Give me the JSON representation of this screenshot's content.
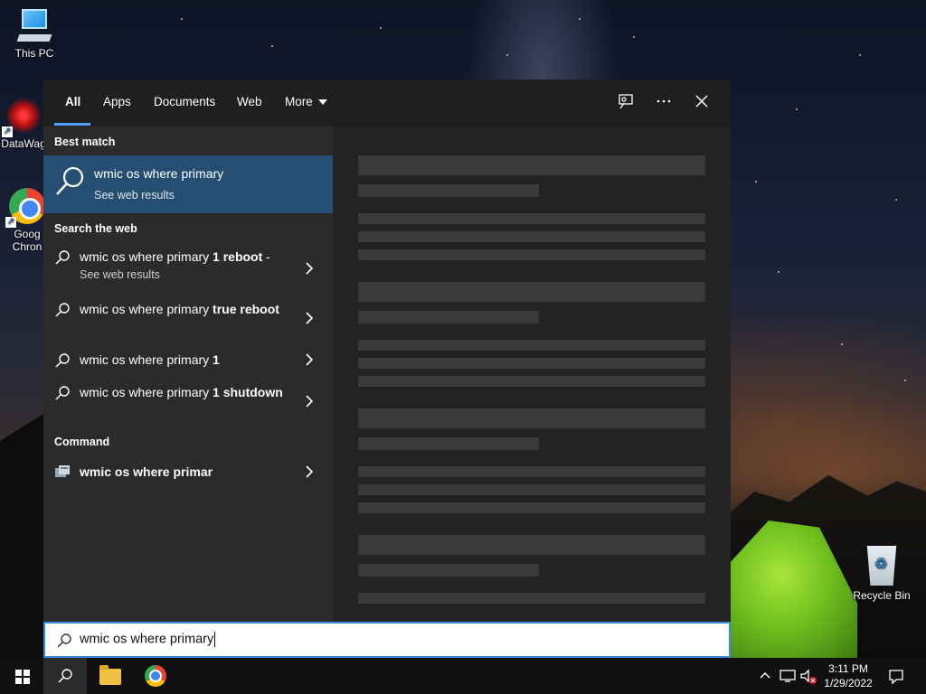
{
  "desktop": {
    "icons": [
      {
        "label": "This PC"
      },
      {
        "label": "DataWag"
      },
      {
        "label": "Goog Chron"
      },
      {
        "label": "Recycle Bin"
      }
    ]
  },
  "search_window": {
    "tabs": [
      {
        "label": "All",
        "active": true
      },
      {
        "label": "Apps"
      },
      {
        "label": "Documents"
      },
      {
        "label": "Web"
      },
      {
        "label": "More"
      }
    ],
    "top_icons": [
      "feedback-icon",
      "more-options-icon",
      "close-icon"
    ],
    "best_match": {
      "heading": "Best match",
      "title": "wmic os where primary",
      "subtitle": "See web results"
    },
    "search_web": {
      "heading": "Search the web",
      "items": [
        {
          "normal": "wmic os where primary ",
          "bold": "1 reboot",
          "tail": " -",
          "sub": "See web results"
        },
        {
          "normal": "wmic os where primary ",
          "bold": "true reboot"
        },
        {
          "normal": "wmic os where primary ",
          "bold": "1"
        },
        {
          "normal": "wmic os where primary ",
          "bold": "1 shutdown"
        }
      ]
    },
    "command": {
      "heading": "Command",
      "item": "wmic os where primar"
    }
  },
  "search_box": {
    "value": "wmic os where primary"
  },
  "taskbar": {
    "time": "3:11 PM",
    "date": "1/29/2022"
  },
  "colors": {
    "accent": "#3a8ee6",
    "best_match_bg": "#264e73",
    "panel_bg": "#2b2b2b"
  }
}
